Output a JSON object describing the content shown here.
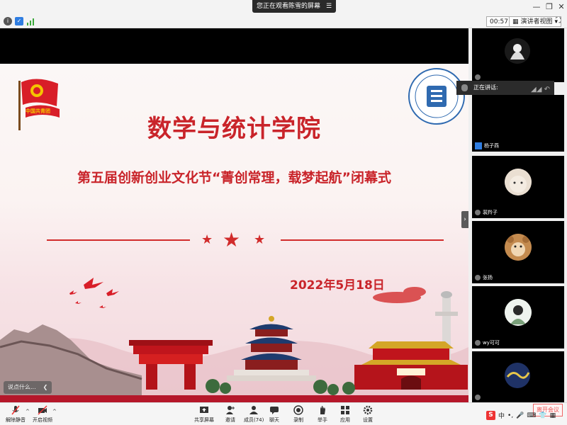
{
  "window": {
    "share_banner_text": "您正在观看陈雪的屏幕",
    "share_banner_icon": "☰",
    "minimize": "—",
    "restore": "❐",
    "close": "✕"
  },
  "infobar": {
    "timer": "00:57",
    "view_mode": "演讲者视图",
    "view_mode_caret": "▾"
  },
  "slide": {
    "title": "数学与统计学院",
    "subtitle": "第五届创新创业文化节“菁创常理，载梦起航”闭幕式",
    "date": "2022年5月18日",
    "league_emblem_text": "中国共青团",
    "stars": [
      "★",
      "★",
      "★"
    ]
  },
  "chat_toggle": {
    "label": "说点什么...",
    "arrow": "❮"
  },
  "speaking": {
    "label": "正在讲话:"
  },
  "participants": [
    {
      "name": ""
    },
    {
      "name": "杨子燕"
    },
    {
      "name": "裴羚子"
    },
    {
      "name": "张扬"
    },
    {
      "name": "wy可可"
    },
    {
      "name": ""
    }
  ],
  "toolbar": {
    "unmute": "解除静音",
    "start_video": "开启视频",
    "share_screen": "共享屏幕",
    "invite": "邀请",
    "members": "成员(74)",
    "chat": "聊天",
    "record": "录制",
    "raise_hand": "举手",
    "apps": "应用",
    "settings": "设置"
  },
  "ime": {
    "lang": "中",
    "icons": [
      "•,",
      "🎤",
      "⌨",
      "👕",
      "▦"
    ]
  },
  "bottom_right_badge": "离开会议",
  "colors": {
    "accent_red": "#c9242a",
    "toolbar_bg": "#f5f5f5",
    "stage_bg": "#000000"
  }
}
